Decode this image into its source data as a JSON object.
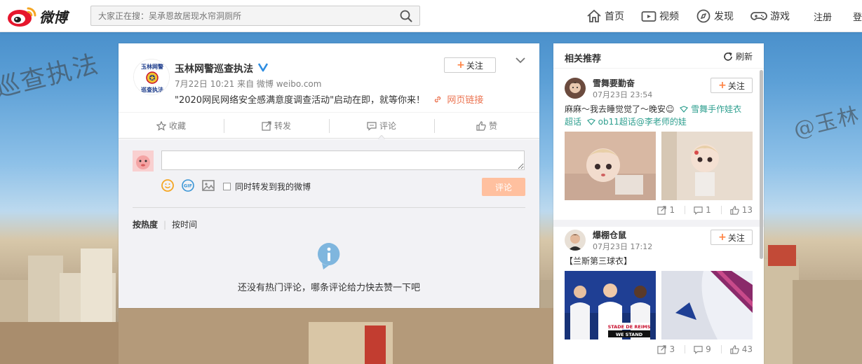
{
  "topbar": {
    "logo_text": "微博",
    "search_placeholder": "大家正在搜：吴承恩故居现水帘洞厕所",
    "nav": [
      {
        "label": "首页",
        "icon": "home-icon"
      },
      {
        "label": "视频",
        "icon": "video-icon"
      },
      {
        "label": "发现",
        "icon": "compass-icon"
      },
      {
        "label": "游戏",
        "icon": "gamepad-icon"
      }
    ],
    "register_label": "注册",
    "login_label": "登"
  },
  "post": {
    "avatar_text_top": "玉林网警",
    "avatar_text_bottom": "巡查执法",
    "author": "玉林网警巡查执法",
    "meta": "7月22日 10:21 来自 微博 weibo.com",
    "text": "\"2020网民网络安全感满意度调查活动\"启动在即，就等你来！",
    "link_label": "网页链接",
    "follow_label": "关注",
    "actions": {
      "favorite": "收藏",
      "repost": "转发",
      "comment": "评论",
      "like": "赞"
    }
  },
  "comment": {
    "input_value": "",
    "checkbox_label": "同时转发到我的微博",
    "submit_label": "评论",
    "sort_hot": "按热度",
    "sort_time": "按时间",
    "empty_message": "还没有热门评论，哪条评论给力快去赞一下吧"
  },
  "sidebar": {
    "title": "相关推荐",
    "refresh_label": "刷新",
    "items": [
      {
        "name": "雪舞要勤奋",
        "time": "07月23日 23:54",
        "follow_label": "关注",
        "text_main": "麻麻～我去睡觉觉了～晚安☺",
        "tag1": "雪舞手作娃衣超话",
        "tag1_a": "雪舞手作娃衣",
        "tag1_b": "超话",
        "tag2": "ob11超话@李老师的娃",
        "reposts": "1",
        "comments": "1",
        "likes": "13"
      },
      {
        "name": "爆棚仓鼠",
        "time": "07月23日 17:12",
        "follow_label": "关注",
        "text_main": "【兰斯第三球衣】",
        "img_caption_1": "STADE DE REIMS",
        "img_caption_2": "WE STAND",
        "reposts": "3",
        "comments": "9",
        "likes": "43"
      }
    ]
  },
  "background": {
    "watermark_left": "巡查执法",
    "watermark_right": "@玉林"
  },
  "colors": {
    "accent": "#eb7350",
    "plus": "#ff8140",
    "vbadge": "#2e8de1",
    "submit_disabled": "#ffc09f"
  }
}
